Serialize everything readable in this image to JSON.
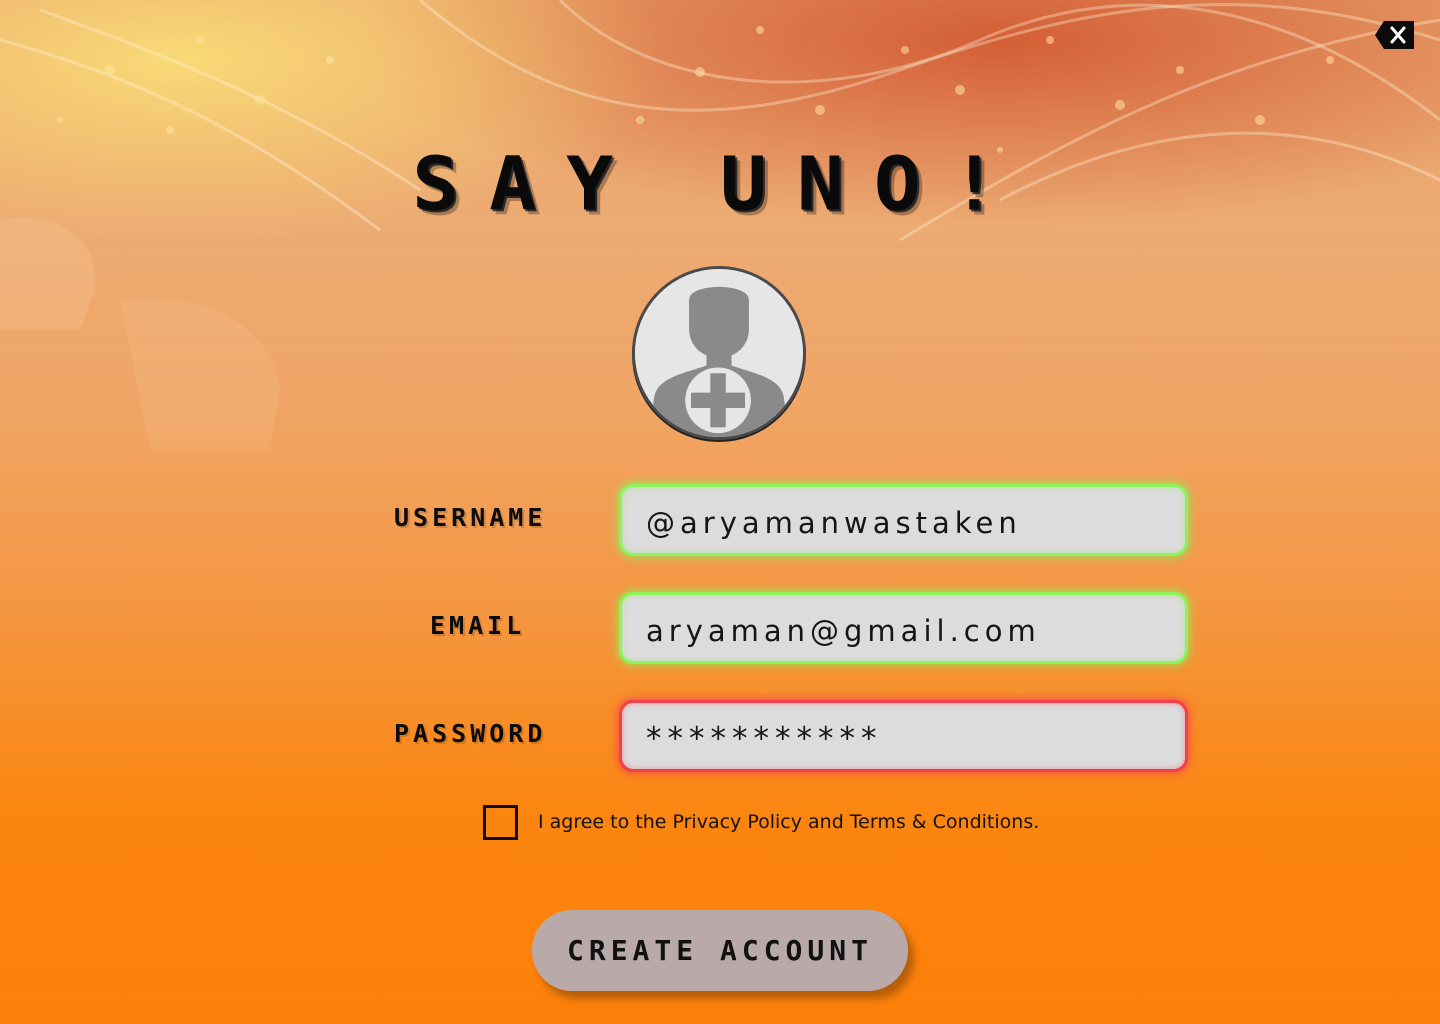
{
  "app": {
    "title": "SAY UNO!"
  },
  "header": {
    "close_icon": "close-icon"
  },
  "avatar": {
    "icon": "add-user-icon"
  },
  "form": {
    "username": {
      "label": "USERNAME",
      "value": "@aryamanwastaken",
      "status_color": "#8ef25a"
    },
    "email": {
      "label": "EMAIL",
      "value": "aryaman@gmail.com",
      "status_color": "#8ef25a"
    },
    "password": {
      "label": "PASSWORD",
      "value": "***********",
      "status_color": "#f2404a"
    },
    "agreement": {
      "text": "I agree to the Privacy Policy and Terms & Conditions.",
      "checked": false
    },
    "submit_label": "CREATE ACCOUNT"
  },
  "colors": {
    "background_top": "#e9a56e",
    "background_bottom": "#fd800a",
    "button": "#baa9a9",
    "field": "#dcdcdc"
  }
}
